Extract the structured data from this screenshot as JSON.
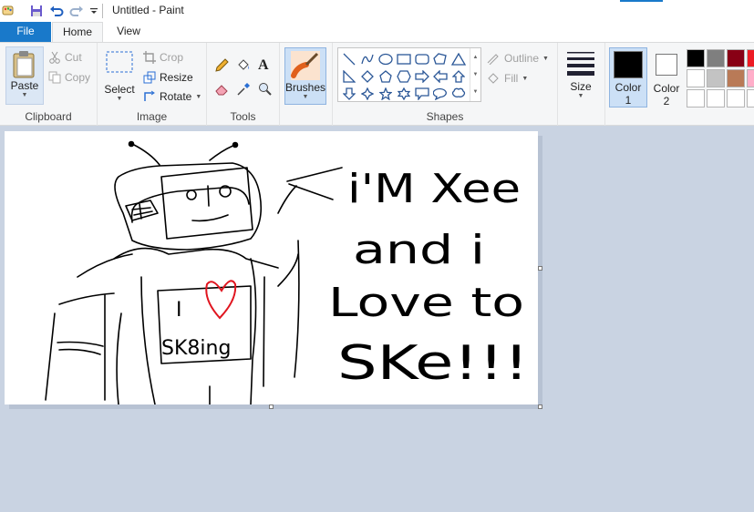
{
  "window": {
    "title": "Untitled - Paint"
  },
  "tabs": {
    "file": "File",
    "home": "Home",
    "view": "View"
  },
  "clipboard": {
    "paste": "Paste",
    "cut": "Cut",
    "copy": "Copy",
    "group": "Clipboard"
  },
  "image": {
    "select": "Select",
    "crop": "Crop",
    "resize": "Resize",
    "rotate": "Rotate",
    "group": "Image"
  },
  "tools": {
    "group": "Tools"
  },
  "brushes": {
    "label": "Brushes"
  },
  "shapes": {
    "group": "Shapes",
    "outline": "Outline",
    "fill": "Fill"
  },
  "size": {
    "label": "Size"
  },
  "colors": {
    "color1_label": "Color",
    "color1_num": "1",
    "color2_label": "Color",
    "color2_num": "2",
    "color1": "#000000",
    "color2": "#ffffff",
    "palette": [
      "#000000",
      "#7f7f7f",
      "#880015",
      "#ed1c24",
      "#ffffff",
      "#c3c3c3",
      "#b97a57",
      "#ffaec9",
      "#ffffff",
      "#ffffff",
      "#ffffff",
      "#ffffff"
    ]
  },
  "drawing": {
    "heart_text_left": "I",
    "sk8ing": "SK8ing",
    "line1": "i'M Xee",
    "line2": "and i",
    "line3": "Love to",
    "line4": "SKe!!!",
    "ink_color": "#000000",
    "heart_color": "#e0151f"
  }
}
